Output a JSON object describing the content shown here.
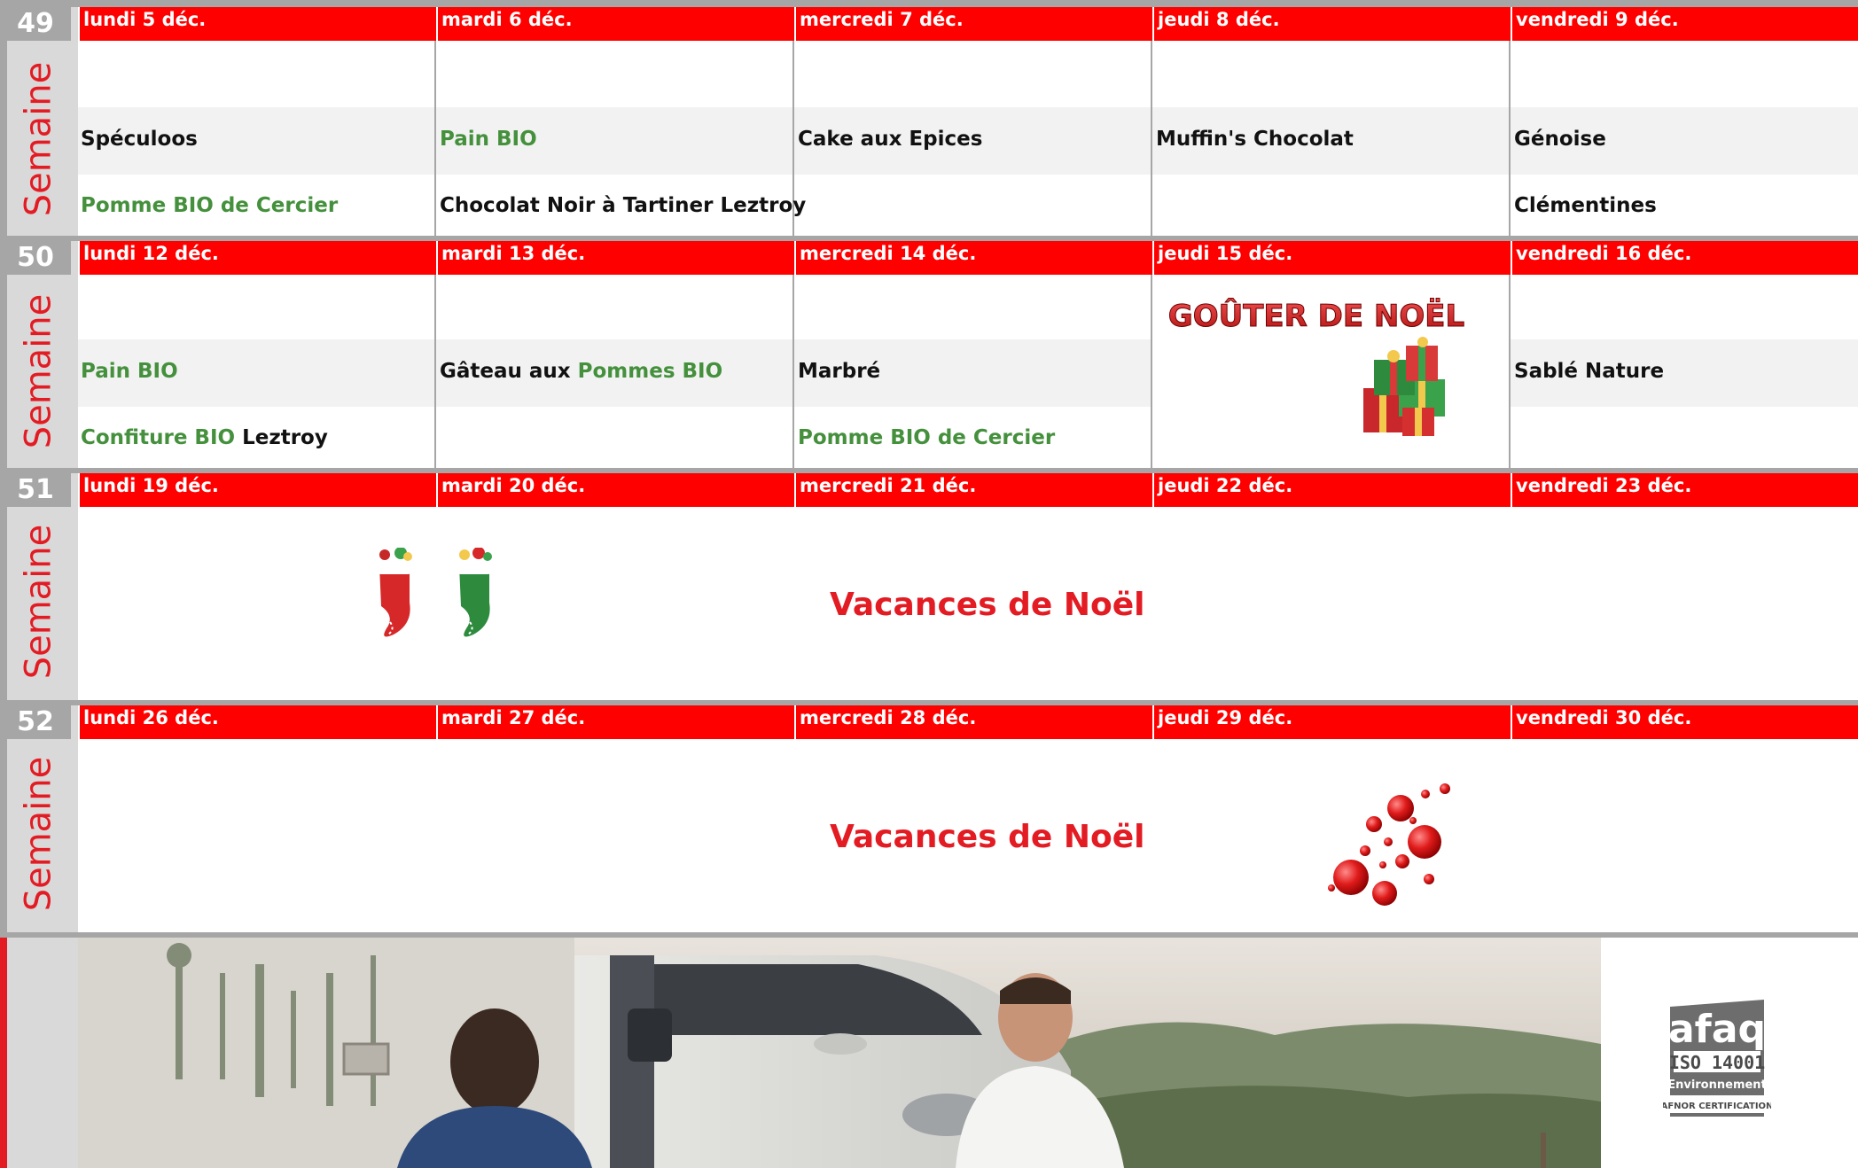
{
  "weeks": [
    {
      "num": "49",
      "label": "Semaine",
      "days": [
        "lundi 5 déc.",
        "mardi 6 déc.",
        "mercredi 7 déc.",
        "jeudi 8 déc.",
        "vendredi 9 déc."
      ],
      "row1": {
        "c0": "Spéculoos",
        "c1": "Pain BIO",
        "c2": "Cake aux Epices",
        "c3": "Muffin's Chocolat",
        "c4": "Génoise"
      },
      "row2": {
        "c0": "Pomme BIO de Cercier",
        "c1": "Chocolat Noir à Tartiner Leztroy",
        "c4": "Clémentines"
      }
    },
    {
      "num": "50",
      "label": "Semaine",
      "days": [
        "lundi 12 déc.",
        "mardi 13 déc.",
        "mercredi 14 déc.",
        "jeudi 15 déc.",
        "vendredi 16 déc."
      ],
      "row1": {
        "c0": "Pain BIO",
        "c1a": "Gâteau aux ",
        "c1b": "Pommes BIO",
        "c2": "Marbré",
        "c4": "Sablé Nature"
      },
      "row2": {
        "c0a": "Confiture BIO",
        "c0b": " Leztroy",
        "c2": "Pomme BIO de Cercier"
      },
      "special": "GOÛTER DE NOËL"
    },
    {
      "num": "51",
      "label": "Semaine",
      "days": [
        "lundi 19 déc.",
        "mardi 20 déc.",
        "mercredi 21 déc.",
        "jeudi 22 déc.",
        "vendredi 23 déc."
      ],
      "holiday": "Vacances de Noël"
    },
    {
      "num": "52",
      "label": "Semaine",
      "days": [
        "lundi 26 déc.",
        "mardi 27 déc.",
        "mercredi 28 déc.",
        "jeudi 29 déc.",
        "vendredi 30 déc."
      ],
      "holiday": "Vacances de Noël"
    }
  ],
  "logo": {
    "brand": "afaq",
    "standard": "ISO 14001",
    "scope": "Environnement",
    "issuer": "AFNOR CERTIFICATION"
  },
  "colors": {
    "header_red": "#ff0000",
    "text_red": "#e31b23",
    "bio_green": "#44903c",
    "side_grey": "#d9d9d9"
  }
}
